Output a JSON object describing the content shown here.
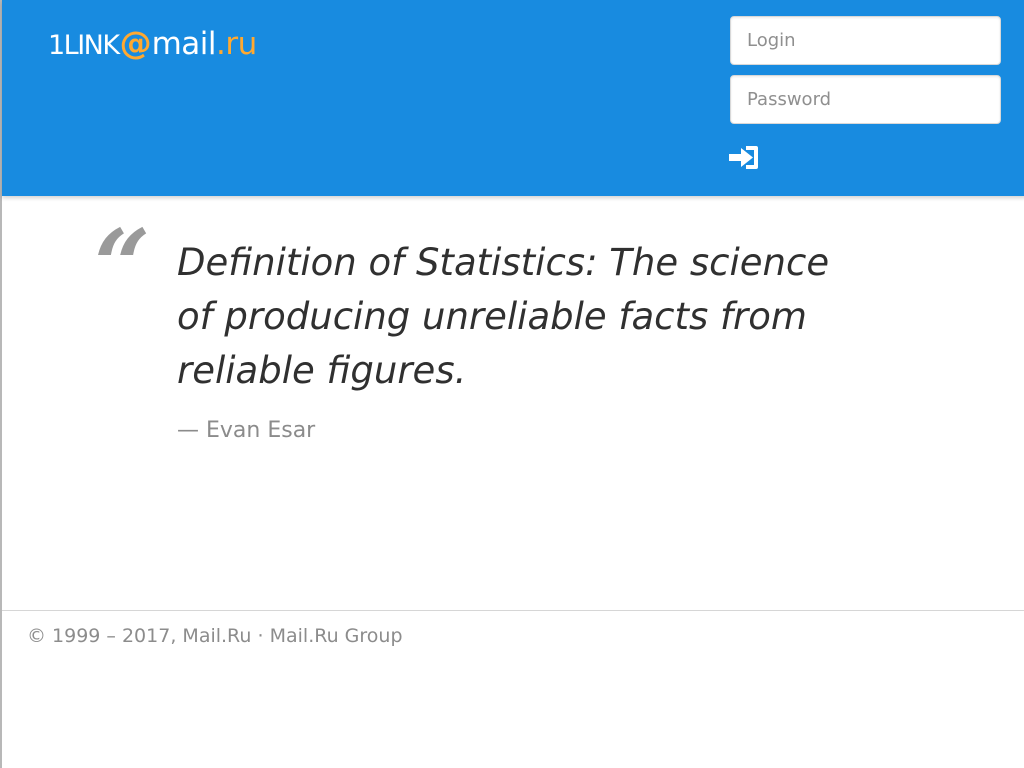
{
  "header": {
    "background_color": "#188be0",
    "logo": {
      "prefix": "1LINK",
      "at": "@",
      "mail": "mail",
      "dot_ru": ".ru",
      "accent_color": "#ffa930"
    },
    "login_form": {
      "login_placeholder": "Login",
      "password_placeholder": "Password",
      "login_value": "",
      "password_value": "",
      "signin_icon": "sign-in-arrow-icon"
    }
  },
  "quote": {
    "quote_icon": "quote-mark-icon",
    "mark": "“",
    "text": "Definition of Statistics: The science of producing unreliable facts from reliable figures.",
    "author": "— Evan Esar"
  },
  "footer": {
    "copyright": "© 1999 – 2017,",
    "mail_link": "Mail.Ru",
    "separator": "·",
    "group_link": "Mail.Ru Group"
  }
}
